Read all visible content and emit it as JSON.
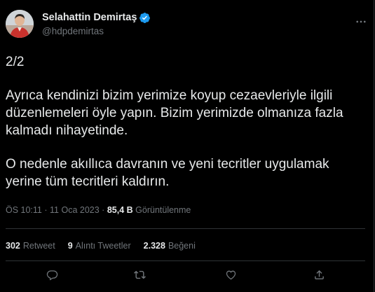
{
  "user": {
    "display_name": "Selahattin Demirtaş",
    "handle": "@hdpdemirtas",
    "avatar": "profile-photo",
    "verified_color": "#1d9bf0"
  },
  "tweet": {
    "counter": "2/2",
    "paragraph_1": "Ayrıca kendinizi bizim yerimize koyup cezaevleriyle ilgili düzenlemeleri öyle yapın. Bizim yerimizde olmanıza fazla kalmadı nihayetinde.",
    "paragraph_2": "O nedenle akıllıca davranın ve yeni tecritler uygulamak yerine tüm tecritleri kaldırın."
  },
  "meta": {
    "time": "ÖS 10:11",
    "separator": "·",
    "date": "11 Oca 2023",
    "views_count": "85,4 B",
    "views_label": "Görüntülenme"
  },
  "stats": {
    "retweets_count": "302",
    "retweets_label": "Retweet",
    "quotes_count": "9",
    "quotes_label": "Alıntı Tweetler",
    "likes_count": "2.328",
    "likes_label": "Beğeni"
  },
  "icons": {
    "more": "more-icon",
    "reply": "reply-icon",
    "retweet": "retweet-icon",
    "like": "heart-icon",
    "share": "share-icon"
  },
  "colors": {
    "background": "#000000",
    "text": "#e7e9ea",
    "secondary": "#71767b",
    "divider": "#2f3336"
  }
}
